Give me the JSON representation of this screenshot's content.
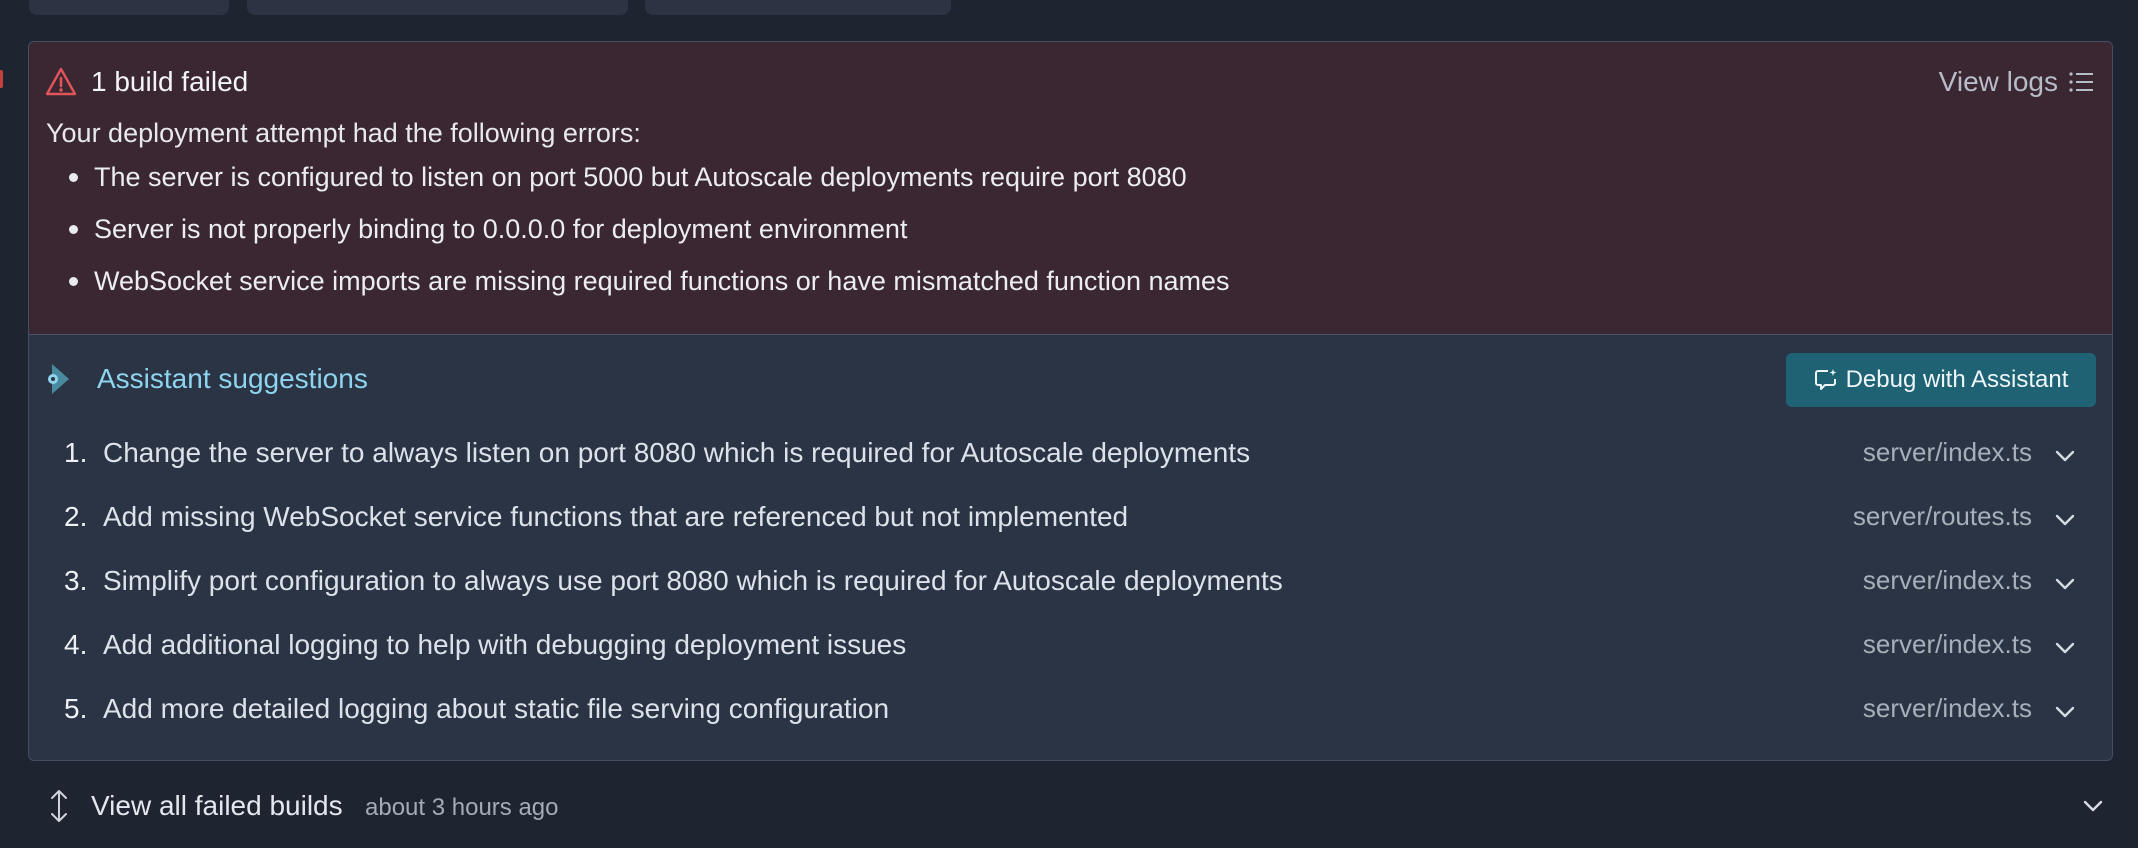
{
  "build": {
    "title": "1 build failed",
    "view_logs_label": "View logs",
    "intro": "Your deployment attempt had the following errors:",
    "errors": [
      "The server is configured to listen on port 5000 but Autoscale deployments require port 8080",
      "Server is not properly binding to 0.0.0.0 for deployment environment",
      "WebSocket service imports are missing required functions or have mismatched function names"
    ]
  },
  "assistant": {
    "title": "Assistant suggestions",
    "debug_button": "Debug with Assistant",
    "suggestions": [
      {
        "num": "1.",
        "text": "Change the server to always listen on port 8080 which is required for Autoscale deployments",
        "file": "server/index.ts"
      },
      {
        "num": "2.",
        "text": "Add missing WebSocket service functions that are referenced but not implemented",
        "file": "server/routes.ts"
      },
      {
        "num": "3.",
        "text": "Simplify port configuration to always use port 8080 which is required for Autoscale deployments",
        "file": "server/index.ts"
      },
      {
        "num": "4.",
        "text": "Add additional logging to help with debugging deployment issues",
        "file": "server/index.ts"
      },
      {
        "num": "5.",
        "text": "Add more detailed logging about static file serving configuration",
        "file": "server/index.ts"
      }
    ]
  },
  "footer": {
    "label": "View all failed builds",
    "time": "about 3 hours ago"
  },
  "icons": {
    "warning": "warning-triangle-icon",
    "logs": "list-icon",
    "assistant": "assistant-icon",
    "debug": "chat-sparkle-icon",
    "chevron": "chevron-down-icon",
    "expand": "expand-vertical-icon"
  },
  "colors": {
    "page_bg": "#1f2431",
    "error_bg": "#3b2731",
    "suggest_bg": "#2a3444",
    "accent": "#8fd4ef",
    "debug_button": "#1f6274",
    "warning": "#e0545a"
  }
}
